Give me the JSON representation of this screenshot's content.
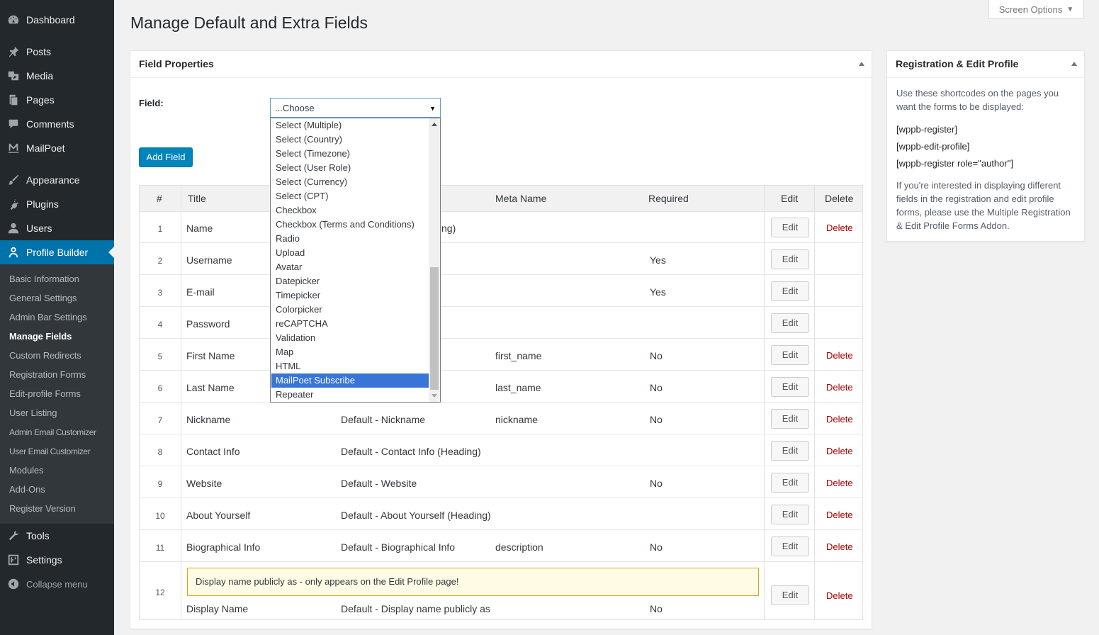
{
  "menu": {
    "items": [
      {
        "label": "Dashboard",
        "icon": "dashboard-icon"
      },
      {
        "label": "Posts",
        "icon": "pin-icon"
      },
      {
        "label": "Media",
        "icon": "media-icon"
      },
      {
        "label": "Pages",
        "icon": "pages-icon"
      },
      {
        "label": "Comments",
        "icon": "comment-icon"
      },
      {
        "label": "MailPoet",
        "icon": "mailpoet-icon"
      },
      {
        "label": "Appearance",
        "icon": "brush-icon"
      },
      {
        "label": "Plugins",
        "icon": "plugin-icon"
      },
      {
        "label": "Users",
        "icon": "user-icon"
      },
      {
        "label": "Profile Builder",
        "icon": "profile-icon"
      },
      {
        "label": "Tools",
        "icon": "wrench-icon"
      },
      {
        "label": "Settings",
        "icon": "settings-icon"
      },
      {
        "label": "Collapse menu",
        "icon": "collapse-icon"
      }
    ],
    "submenu": [
      "Basic Information",
      "General Settings",
      "Admin Bar Settings",
      "Manage Fields",
      "Custom Redirects",
      "Registration Forms",
      "Edit-profile Forms",
      "User Listing",
      "Admin Email Customizer",
      "User Email Customizer",
      "Modules",
      "Add-Ons",
      "Register Version"
    ]
  },
  "header": {
    "title": "Manage Default and Extra Fields",
    "screen_options": "Screen Options"
  },
  "field_properties": {
    "title": "Field Properties",
    "field_label": "Field:",
    "select_value": "...Choose",
    "add_button": "Add Field",
    "options": [
      "Select (Multiple)",
      "Select (Country)",
      "Select (Timezone)",
      "Select (User Role)",
      "Select (Currency)",
      "Select (CPT)",
      "Checkbox",
      "Checkbox (Terms and Conditions)",
      "Radio",
      "Upload",
      "Avatar",
      "Datepicker",
      "Timepicker",
      "Colorpicker",
      "reCAPTCHA",
      "Validation",
      "Map",
      "HTML",
      "MailPoet Subscribe",
      "Repeater"
    ],
    "selected_option": "MailPoet Subscribe"
  },
  "table": {
    "headers": {
      "num": "#",
      "title": "Title",
      "meta": "Meta Name",
      "required": "Required",
      "edit": "Edit",
      "delete": "Delete"
    },
    "edit_label": "Edit",
    "delete_label": "Delete",
    "rows": [
      {
        "num": "1",
        "title": "Name",
        "type": "ng)",
        "meta": "",
        "required": "",
        "deletable": true
      },
      {
        "num": "2",
        "title": "Username",
        "type": "",
        "meta": "",
        "required": "Yes",
        "deletable": false
      },
      {
        "num": "3",
        "title": "E-mail",
        "type": "",
        "meta": "",
        "required": "Yes",
        "deletable": false
      },
      {
        "num": "4",
        "title": "Password",
        "type": "",
        "meta": "",
        "required": "",
        "deletable": false
      },
      {
        "num": "5",
        "title": "First Name",
        "type": "",
        "meta": "first_name",
        "required": "No",
        "deletable": true
      },
      {
        "num": "6",
        "title": "Last Name",
        "type": "",
        "meta": "last_name",
        "required": "No",
        "deletable": true
      },
      {
        "num": "7",
        "title": "Nickname",
        "type": "Default - Nickname",
        "meta": "nickname",
        "required": "No",
        "deletable": true
      },
      {
        "num": "8",
        "title": "Contact Info",
        "type": "Default - Contact Info (Heading)",
        "meta": "",
        "required": "",
        "deletable": true
      },
      {
        "num": "9",
        "title": "Website",
        "type": "Default - Website",
        "meta": "",
        "required": "No",
        "deletable": true
      },
      {
        "num": "10",
        "title": "About Yourself",
        "type": "Default - About Yourself (Heading)",
        "meta": "",
        "required": "",
        "deletable": true
      },
      {
        "num": "11",
        "title": "Biographical Info",
        "type": "Default - Biographical Info",
        "meta": "description",
        "required": "No",
        "deletable": true
      },
      {
        "num": "12",
        "title": "Display Name",
        "type": "Default - Display name publicly as",
        "meta": "",
        "required": "No",
        "deletable": true
      }
    ],
    "notice": "Display name publicly as - only appears on the Edit Profile page!"
  },
  "sidebox": {
    "title": "Registration & Edit Profile",
    "intro": "Use these shortcodes on the pages you want the forms to be displayed:",
    "codes": [
      "[wppb-register]",
      "[wppb-edit-profile]",
      "[wppb-register role=\"author\"]"
    ],
    "outro": "If you're interested in displaying different fields in the registration and edit profile forms, please use the Multiple Registration & Edit Profile Forms Addon."
  },
  "colors": {
    "menu_bg": "#23282d",
    "submenu_bg": "#32373c",
    "accent": "#0073aa",
    "delete": "#a00",
    "notice_border": "#dba617"
  }
}
